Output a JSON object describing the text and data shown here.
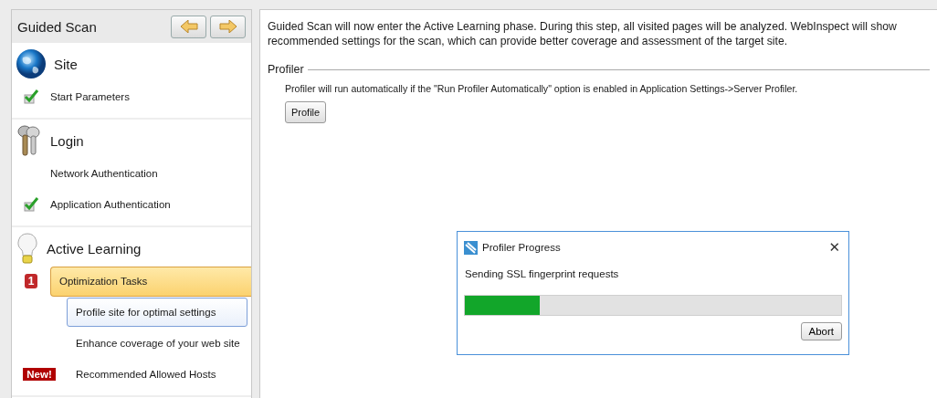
{
  "sidebar": {
    "title": "Guided Scan",
    "sections": [
      {
        "name": "Site",
        "items": [
          {
            "kind": "step",
            "label": "Start Parameters",
            "checked": true
          }
        ]
      },
      {
        "name": "Login",
        "items": [
          {
            "kind": "step",
            "label": "Network Authentication",
            "checked": false
          },
          {
            "kind": "step",
            "label": "Application Authentication",
            "checked": true
          }
        ]
      },
      {
        "name": "Active Learning",
        "items": [
          {
            "kind": "heading",
            "label": "Optimization Tasks",
            "badge": "1",
            "expanded": true
          },
          {
            "kind": "subtask",
            "label": "Profile site for optimal settings",
            "selected": true
          },
          {
            "kind": "subtask",
            "label": "Enhance coverage of your web site",
            "selected": false
          },
          {
            "kind": "subtask",
            "label": "Recommended Allowed Hosts",
            "selected": false,
            "badge": "New!"
          }
        ]
      }
    ]
  },
  "main": {
    "intro": "Guided Scan will now enter the Active Learning phase. During this step, all visited pages will be analyzed.  WebInspect will show recommended settings for the scan, which can provide better coverage and assessment of the target site.",
    "profiler": {
      "legend": "Profiler",
      "note": "Profiler will run automatically if the \"Run Profiler Automatically\" option is enabled in Application Settings->Server Profiler.",
      "button": "Profile"
    }
  },
  "dialog": {
    "title": "Profiler Progress",
    "close": "✕",
    "message": "Sending SSL fingerprint requests",
    "level": 0.2,
    "button": "Abort"
  }
}
